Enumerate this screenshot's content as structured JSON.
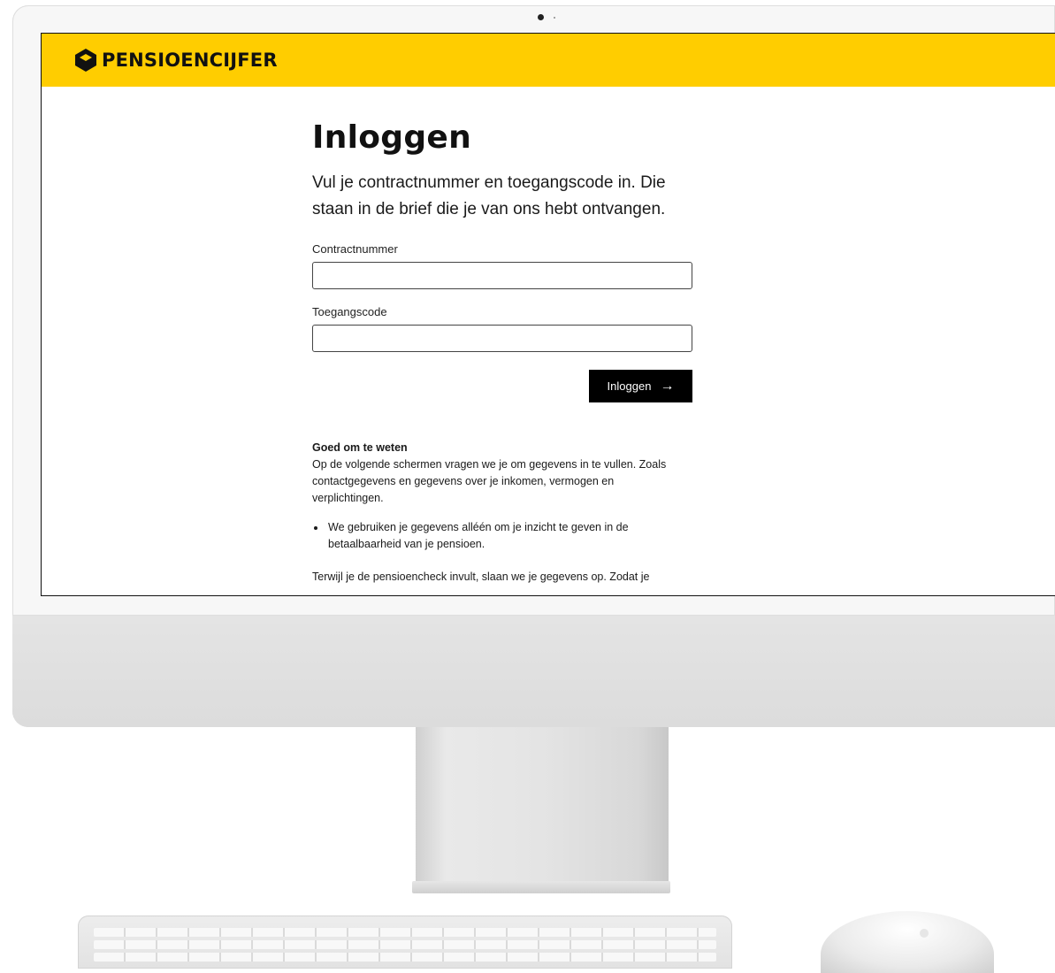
{
  "brand": {
    "name": "PENSIOENCIJFER",
    "color": "#ffcd00"
  },
  "page": {
    "title": "Inloggen",
    "intro": "Vul je contractnummer en toegangscode in. Die staan in de brief die je van ons hebt ontvangen."
  },
  "form": {
    "contract_label": "Contractnummer",
    "contract_value": "",
    "code_label": "Toegangscode",
    "code_value": "",
    "submit_label": "Inloggen",
    "submit_icon": "arrow-right-icon"
  },
  "info": {
    "heading": "Goed om te weten",
    "paragraph": "Op de volgende schermen vragen we je om gegevens in te vullen. Zoals contactgegevens en gegevens over je inkomen, vermogen en verplichtingen.",
    "bullets": [
      "We gebruiken je gegevens alléén om je inzicht te geven in de betaalbaarheid van je pensioen."
    ],
    "cut_off_text": "Terwijl je de pensioencheck invult, slaan we je gegevens op. Zodat je"
  },
  "colors": {
    "button_bg": "#000000",
    "text": "#111111"
  }
}
